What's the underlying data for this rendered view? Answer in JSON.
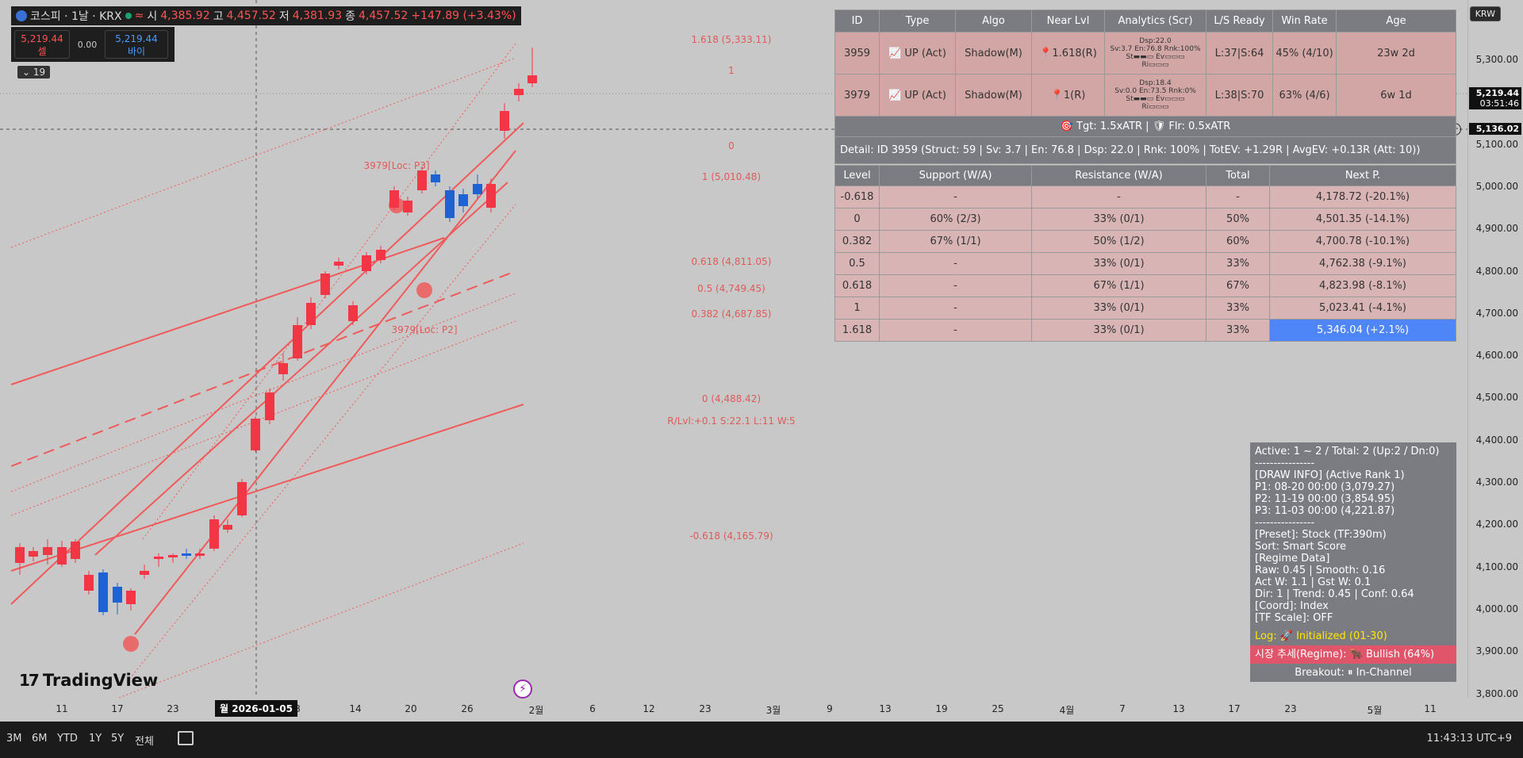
{
  "header": {
    "symbol": "코스피 · 1날 · KRX",
    "open_label": "시",
    "open_value": "4,385.92",
    "high_label": "고",
    "high_value": "4,457.52",
    "low_label": "저",
    "low_value": "4,381.93",
    "close_label": "종",
    "close_value": "4,457.52",
    "change": "+147.89 (+3.43%)",
    "sell_price": "5,219.44",
    "sell_label": "셀",
    "spread": "0.00",
    "buy_price": "5,219.44",
    "buy_label": "바이",
    "indicator_count": "19"
  },
  "price_axis": {
    "currency": "KRW",
    "labels": [
      "5,300.00",
      "5,200.00",
      "5,100.00",
      "5,000.00",
      "4,900.00",
      "4,800.00",
      "4,700.00",
      "4,600.00",
      "4,500.00",
      "4,400.00",
      "4,300.00",
      "4,200.00",
      "4,100.00",
      "4,000.00",
      "3,900.00",
      "3,800.00"
    ],
    "last_price": "5,219.44",
    "countdown": "03:51:46",
    "crosshair_price": "5,136.02"
  },
  "time_axis": {
    "labels": [
      "11",
      "17",
      "23",
      "8",
      "14",
      "20",
      "26",
      "2월",
      "6",
      "12",
      "23",
      "3월",
      "9",
      "13",
      "19",
      "25",
      "4월",
      "7",
      "13",
      "17",
      "23",
      "5월",
      "11"
    ],
    "crosshair_date": "월 2026-01-05"
  },
  "chart_notes": {
    "fib_1618": "1.618 (5,333.11)",
    "fib_1": "1",
    "fib_0": "0",
    "fib_1_val": "1 (5,010.48)",
    "fib_0618": "0.618 (4,811.05)",
    "fib_05": "0.5 (4,749.45)",
    "fib_0382": "0.382 (4,687.85)",
    "fib_0_val": "0 (4,488.42)",
    "rlvl": "R/Lvl:+0.1 S:22.1 L:11 W:5",
    "fib_m0618": "-0.618 (4,165.79)",
    "loc_p3": "3979[Loc: P3]",
    "loc_p2": "3979[Loc: P2]"
  },
  "info_table": {
    "headers": [
      "ID",
      "Type",
      "Algo",
      "Near Lvl",
      "Analytics (Scr)",
      "L/S Ready",
      "Win Rate",
      "Age"
    ],
    "rows": [
      {
        "id": "3959",
        "type": "UP (Act)",
        "algo": "Shadow(M)",
        "near": "1.618(R)",
        "an1": "Dsp:22.0",
        "an2": "Sv:3.7 En:76.8 Rnk:100%",
        "an3": "St▬▬▭ Ev▭▭▭",
        "an4": "Ri▭▭▭",
        "ls": "L:37|S:64",
        "win": "45% (4/10)",
        "age": "23w 2d"
      },
      {
        "id": "3979",
        "type": "UP (Act)",
        "algo": "Shadow(M)",
        "near": "1(R)",
        "an1": "Dsp:18.4",
        "an2": "Sv:0.0 En:73.5 Rnk:0%",
        "an3": "St▬▬▭ Ev▭▭▭",
        "an4": "Ri▭▭▭",
        "ls": "L:38|S:70",
        "win": "63% (4/6)",
        "age": "6w 1d"
      }
    ],
    "target_line": "Tgt: 1.5xATR |",
    "floor_line": "Flr: 0.5xATR",
    "detail": "Detail: ID 3959 (Struct: 59 | Sv: 3.7 | En: 76.8 | Dsp: 22.0 | Rnk: 100% | TotEV: +1.29R | AvgEV: +0.13R (Att: 10))",
    "level_headers": [
      "Level",
      "Support (W/A)",
      "Resistance (W/A)",
      "Total",
      "Next P."
    ],
    "levels": [
      {
        "lvl": "-0.618",
        "sup": "-",
        "res": "-",
        "tot": "-",
        "next": "4,178.72 (-20.1%)"
      },
      {
        "lvl": "0",
        "sup": "60% (2/3)",
        "res": "33% (0/1)",
        "tot": "50%",
        "next": "4,501.35 (-14.1%)"
      },
      {
        "lvl": "0.382",
        "sup": "67% (1/1)",
        "res": "50% (1/2)",
        "tot": "60%",
        "next": "4,700.78 (-10.1%)"
      },
      {
        "lvl": "0.5",
        "sup": "-",
        "res": "33% (0/1)",
        "tot": "33%",
        "next": "4,762.38 (-9.1%)"
      },
      {
        "lvl": "0.618",
        "sup": "-",
        "res": "67% (1/1)",
        "tot": "67%",
        "next": "4,823.98 (-8.1%)"
      },
      {
        "lvl": "1",
        "sup": "-",
        "res": "33% (0/1)",
        "tot": "33%",
        "next": "5,023.41 (-4.1%)"
      },
      {
        "lvl": "1.618",
        "sup": "-",
        "res": "33% (0/1)",
        "tot": "33%",
        "next": "5,346.04 (+2.1%)"
      }
    ]
  },
  "side_panel": {
    "lines": [
      "Active: 1 ~ 2 / Total: 2 (Up:2 / Dn:0)",
      "----------------",
      "[DRAW INFO] (Active Rank 1)",
      "P1: 08-20 00:00 (3,079.27)",
      "P2: 11-19 00:00 (3,854.95)",
      "P3: 11-03 00:00 (4,221.87)",
      "----------------",
      "[Preset]: Stock (TF:390m)",
      "Sort: Smart Score",
      "[Regime Data]",
      "Raw: 0.45 | Smooth: 0.16",
      "Act W: 1.1 | Gst W: 0.1",
      "Dir: 1 | Trend: 0.45 | Conf: 0.64",
      "[Coord]: Index",
      "[TF Scale]: OFF"
    ],
    "log_label": "Log:",
    "log_value": "Initialized (01-30)",
    "regime_label": "시장 추세(Regime):",
    "regime_value": "Bullish (64%)",
    "breakout_label": "Breakout:",
    "breakout_value": "In-Channel"
  },
  "bottom_bar": {
    "timeframes": [
      "3M",
      "6M",
      "YTD",
      "1Y",
      "5Y",
      "전체"
    ],
    "clock": "11:43:13 UTC+9"
  },
  "watermark": "TradingView",
  "colors": {
    "bull": "#f23645",
    "bear": "#1e63d6",
    "channel": "#f05a5a",
    "panel": "#7b7c82",
    "highlight": "#4f86f7"
  }
}
